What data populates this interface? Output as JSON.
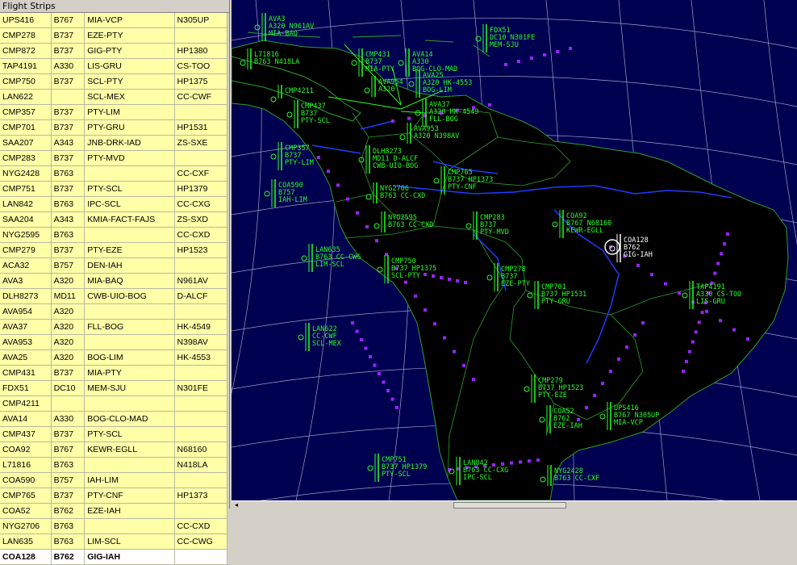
{
  "window_title": "Flight Strips",
  "strips": [
    {
      "callsign": "UPS416",
      "type": "B767",
      "route": "MIA-VCP",
      "reg": "N305UP"
    },
    {
      "callsign": "CMP278",
      "type": "B737",
      "route": "EZE-PTY",
      "reg": ""
    },
    {
      "callsign": "CMP872",
      "type": "B737",
      "route": "GIG-PTY",
      "reg": "HP1380"
    },
    {
      "callsign": "TAP4191",
      "type": "A330",
      "route": "LIS-GRU",
      "reg": "CS-TOO"
    },
    {
      "callsign": "CMP750",
      "type": "B737",
      "route": "SCL-PTY",
      "reg": "HP1375"
    },
    {
      "callsign": "LAN622",
      "type": "",
      "route": "SCL-MEX",
      "reg": "CC-CWF"
    },
    {
      "callsign": "CMP357",
      "type": "B737",
      "route": "PTY-LIM",
      "reg": ""
    },
    {
      "callsign": "CMP701",
      "type": "B737",
      "route": "PTY-GRU",
      "reg": "HP1531"
    },
    {
      "callsign": "SAA207",
      "type": "A343",
      "route": "JNB-DRK-IAD",
      "reg": "ZS-SXE"
    },
    {
      "callsign": "CMP283",
      "type": "B737",
      "route": "PTY-MVD",
      "reg": ""
    },
    {
      "callsign": "NYG2428",
      "type": "B763",
      "route": "",
      "reg": "CC-CXF"
    },
    {
      "callsign": "CMP751",
      "type": "B737",
      "route": "PTY-SCL",
      "reg": "HP1379"
    },
    {
      "callsign": "LAN842",
      "type": "B763",
      "route": "IPC-SCL",
      "reg": "CC-CXG"
    },
    {
      "callsign": "SAA204",
      "type": "A343",
      "route": "KMIA-FACT-FAJS",
      "reg": "ZS-SXD"
    },
    {
      "callsign": "NYG2595",
      "type": "B763",
      "route": "",
      "reg": "CC-CXD"
    },
    {
      "callsign": "CMP279",
      "type": "B737",
      "route": "PTY-EZE",
      "reg": "HP1523"
    },
    {
      "callsign": "ACA32",
      "type": "B757",
      "route": "DEN-IAH",
      "reg": ""
    },
    {
      "callsign": "AVA3",
      "type": "A320",
      "route": "MIA-BAQ",
      "reg": "N961AV"
    },
    {
      "callsign": "DLH8273",
      "type": "MD11",
      "route": "CWB-UIO-BOG",
      "reg": "D-ALCF"
    },
    {
      "callsign": "AVA954",
      "type": "A320",
      "route": "",
      "reg": ""
    },
    {
      "callsign": "AVA37",
      "type": "A320",
      "route": "FLL-BOG",
      "reg": "HK-4549"
    },
    {
      "callsign": "AVA953",
      "type": "A320",
      "route": "",
      "reg": "N398AV"
    },
    {
      "callsign": "AVA25",
      "type": "A320",
      "route": "BOG-LIM",
      "reg": "HK-4553"
    },
    {
      "callsign": "CMP431",
      "type": "B737",
      "route": "MIA-PTY",
      "reg": ""
    },
    {
      "callsign": "FDX51",
      "type": "DC10",
      "route": "MEM-SJU",
      "reg": "N301FE"
    },
    {
      "callsign": "CMP4211",
      "type": "",
      "route": "",
      "reg": ""
    },
    {
      "callsign": "AVA14",
      "type": "A330",
      "route": "BOG-CLO-MAD",
      "reg": ""
    },
    {
      "callsign": "CMP437",
      "type": "B737",
      "route": "PTY-SCL",
      "reg": ""
    },
    {
      "callsign": "COA92",
      "type": "B767",
      "route": "KEWR-EGLL",
      "reg": "N68160"
    },
    {
      "callsign": "L71816",
      "type": "B763",
      "route": "",
      "reg": "N418LA"
    },
    {
      "callsign": "COA590",
      "type": "B757",
      "route": "IAH-LIM",
      "reg": ""
    },
    {
      "callsign": "CMP765",
      "type": "B737",
      "route": "PTY-CNF",
      "reg": "HP1373"
    },
    {
      "callsign": "COA52",
      "type": "B762",
      "route": "EZE-IAH",
      "reg": ""
    },
    {
      "callsign": "NYG2706",
      "type": "B763",
      "route": "",
      "reg": "CC-CXD"
    },
    {
      "callsign": "LAN635",
      "type": "B763",
      "route": "LIM-SCL",
      "reg": "CC-CWG"
    },
    {
      "callsign": "COA128",
      "type": "B762",
      "route": "GIG-IAH",
      "reg": "",
      "selected": true
    }
  ],
  "radar": {
    "colors": {
      "ocean": "#000050",
      "land": "#000000",
      "border": "#2e9e2e",
      "river": "#1e3cff",
      "track": "#9a24ff",
      "label": "#28ff28",
      "selected": "#ffffff"
    },
    "tags": [
      {
        "id": "AVA3",
        "lines": [
          "AVA3",
          "A320 N961AV",
          "MIA-BAQ"
        ]
      },
      {
        "id": "FDX51",
        "lines": [
          "FDX51",
          "DC10 N301FE",
          "MEM-SJU"
        ]
      },
      {
        "id": "L71816",
        "lines": [
          "L71816",
          "B763 N418LA"
        ]
      },
      {
        "id": "CMP431",
        "lines": [
          "CMP431",
          "B737",
          "MIA-PTY"
        ]
      },
      {
        "id": "AVA14",
        "lines": [
          "AVA14",
          "A330",
          "BOG-CLO-MAD"
        ]
      },
      {
        "id": "AVA954",
        "lines": [
          "AVA954",
          "A320"
        ]
      },
      {
        "id": "AVA25",
        "lines": [
          "AVA25",
          "A320 HK-4553",
          "BOG-LIM"
        ]
      },
      {
        "id": "CMP4211",
        "lines": [
          "CMP4211"
        ]
      },
      {
        "id": "AVA37",
        "lines": [
          "AVA37",
          "A320 HK-4549",
          "FLL-BOG"
        ]
      },
      {
        "id": "CMP437",
        "lines": [
          "CMP437",
          "B737",
          "PTY-SCL"
        ]
      },
      {
        "id": "AVA953",
        "lines": [
          "AVA953",
          "A320 N398AV"
        ]
      },
      {
        "id": "CMP357",
        "lines": [
          "CMP357",
          "B737",
          "PTY-LIM"
        ]
      },
      {
        "id": "DLH8273",
        "lines": [
          "DLH8273",
          "MD11 D-ALCF",
          "CWB-UIO-BOG"
        ]
      },
      {
        "id": "CMP765",
        "lines": [
          "CMP765",
          "B737 HP1373",
          "PTY-CNF"
        ]
      },
      {
        "id": "COA590",
        "lines": [
          "COA590",
          "B757",
          "IAH-LIM"
        ]
      },
      {
        "id": "NYG2706",
        "lines": [
          "NYG2706",
          "B763 CC-CXD"
        ]
      },
      {
        "id": "NYG2595",
        "lines": [
          "NYG2595",
          "B763 CC-CXD"
        ]
      },
      {
        "id": "CMP283",
        "lines": [
          "CMP283",
          "B737",
          "PTY-MVD"
        ]
      },
      {
        "id": "COA92",
        "lines": [
          "COA92",
          "B767 N68160",
          "KEWR-EGLL"
        ]
      },
      {
        "id": "COA128",
        "lines": [
          "COA128",
          "B762",
          "GIG-IAH"
        ],
        "selected": true
      },
      {
        "id": "LAN635",
        "lines": [
          "LAN635",
          "B763 CC-CWG",
          "LIM-SCL"
        ]
      },
      {
        "id": "CMP750",
        "lines": [
          "CMP750",
          "B737 HP1375",
          "SCL-PTY"
        ]
      },
      {
        "id": "CMP278",
        "lines": [
          "CMP278",
          "B737",
          "EZE-PTY"
        ]
      },
      {
        "id": "CMP701",
        "lines": [
          "CMP701",
          "B737 HP1531",
          "PTY-GRU"
        ]
      },
      {
        "id": "TAP4191",
        "lines": [
          "TAP4191",
          "A330 CS-TOO",
          "LIS-GRU"
        ]
      },
      {
        "id": "LAN622",
        "lines": [
          "LAN622",
          "CC-CWF",
          "SCL-MEX"
        ]
      },
      {
        "id": "CMP279",
        "lines": [
          "CMP279",
          "B737 HP1523",
          "PTY-EZE"
        ]
      },
      {
        "id": "UPS416",
        "lines": [
          "UPS416",
          "B767 N305UP",
          "MIA-VCP"
        ]
      },
      {
        "id": "COA52",
        "lines": [
          "COA52",
          "B762",
          "EZE-IAH"
        ]
      },
      {
        "id": "CMP751",
        "lines": [
          "CMP751",
          "B737 HP1379",
          "PTY-SCL"
        ]
      },
      {
        "id": "LAN842",
        "lines": [
          "LAN842",
          "B763 CC-CXG",
          "IPC-SCL"
        ]
      },
      {
        "id": "NYG2428",
        "lines": [
          "NYG2428",
          "B763 CC-CXF"
        ]
      }
    ]
  },
  "scrollbar": {
    "left_arrow": "◂"
  }
}
